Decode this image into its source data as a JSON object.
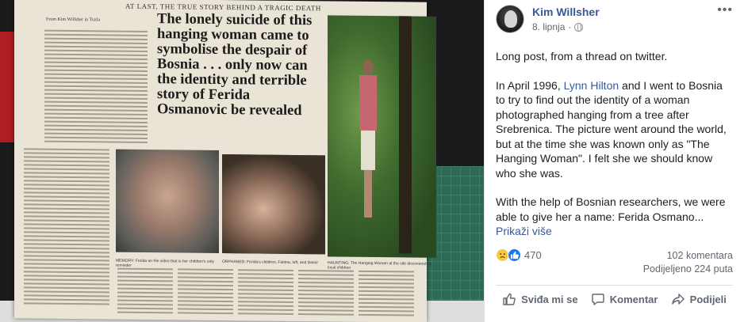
{
  "newspaper": {
    "banner": "AT LAST, THE TRUE STORY BEHIND A TRAGIC DEATH",
    "byline": "From Kim Willsher in Tuzla",
    "headline": "The lonely suicide of this hanging woman came to symbolise the despair of Bosnia . . . only now can the identity and terrible story of Ferida Osmanovic be revealed",
    "caption_left": "MEMORY: Ferida on the video that is her children's only reminder",
    "caption_mid": "ORPHANED: Ferida's children, Fatima, left, and Damir",
    "caption_right": "HAUNTING: The Hanging Woman at the site discovered by local children"
  },
  "post": {
    "author": "Kim Willsher",
    "date": "8. lipnja",
    "more_icon": "more-options-icon",
    "paragraph1": "Long post, from a thread on twitter.",
    "paragraph2_before": "In April 1996, ",
    "paragraph2_link": "Lynn Hilton",
    "paragraph2_after": " and I went to Bosnia to try to find out the identity of a woman photographed hanging from a tree after Srebrenica. The picture went around the world, but at the time she was known only as \"The Hanging Woman\". I felt she we should know who she was.",
    "paragraph3": "With the help of Bosnian researchers, we were able to give her a name: Ferida Osmano...",
    "see_more": "Prikaži više",
    "reaction_count": "470",
    "comments": "102 komentara",
    "shares": "Podijeljeno 224 puta",
    "actions": {
      "like": "Sviđa mi se",
      "comment": "Komentar",
      "share": "Podijeli"
    }
  },
  "colors": {
    "link": "#385898",
    "like_blue": "#1877f2",
    "sad_yellow": "#f7c840"
  }
}
